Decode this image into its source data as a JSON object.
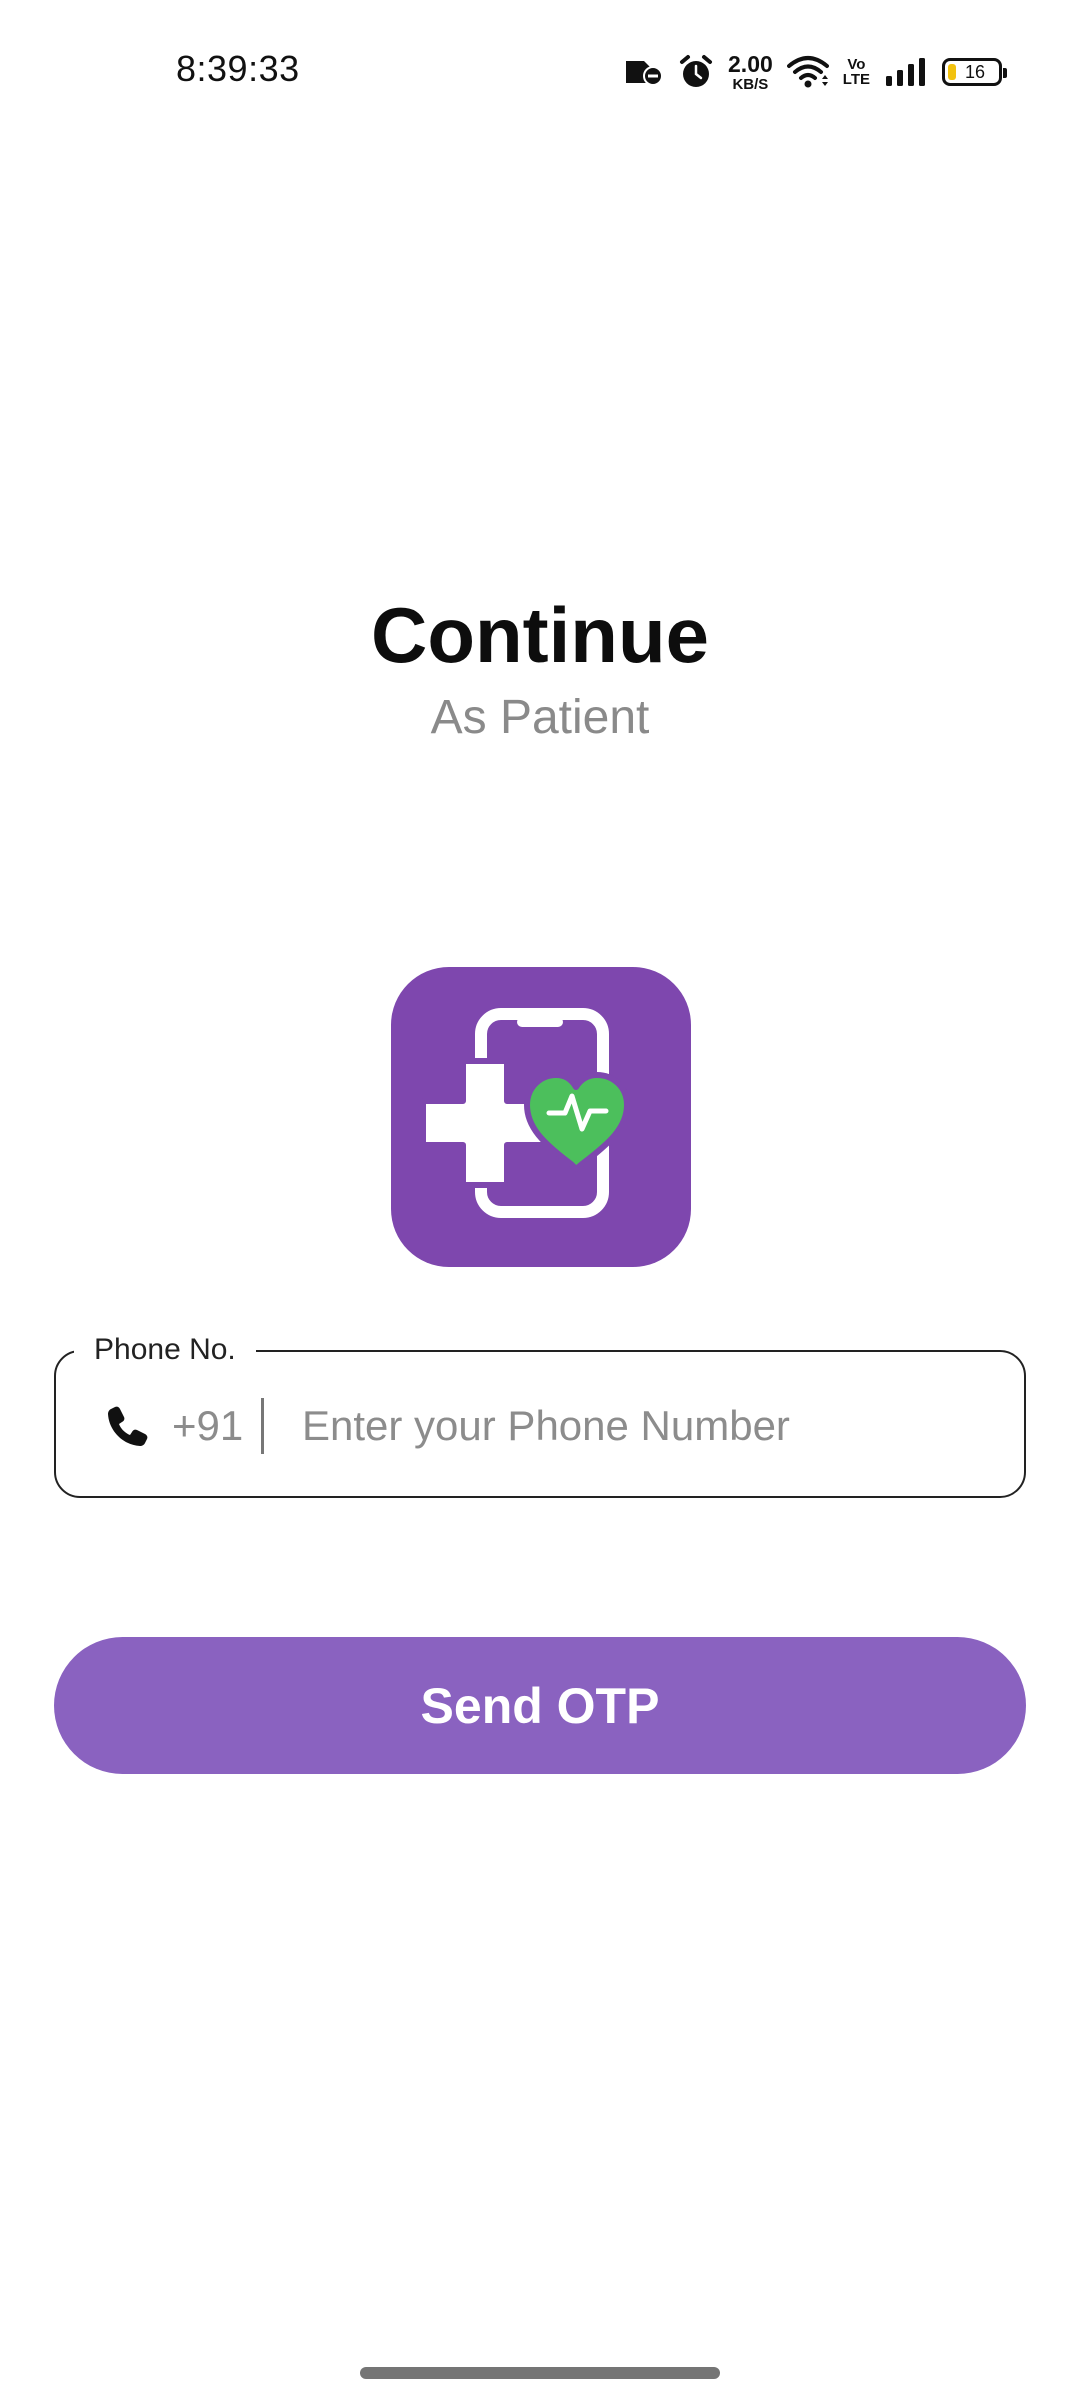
{
  "status_bar": {
    "time": "8:39:33",
    "net_speed_value": "2.00",
    "net_speed_unit": "KB/S",
    "volte_top": "Vo",
    "volte_bottom": "LTE",
    "battery_level": "16",
    "battery_color": "#f2c20f",
    "icons": [
      "sim-off-icon",
      "alarm-icon",
      "wifi-icon",
      "signal-icon",
      "battery-icon"
    ]
  },
  "header": {
    "title": "Continue",
    "subtitle": "As Patient"
  },
  "logo": {
    "icon": "health-app-logo-icon",
    "background_color": "#7e47ae",
    "heart_color": "#4cbf5c"
  },
  "phone_field": {
    "label": "Phone No.",
    "country_code": "+91",
    "placeholder": "Enter your Phone Number",
    "value": "",
    "icon": "phone-icon"
  },
  "actions": {
    "send_otp_label": "Send OTP",
    "button_color": "#8a62c0"
  }
}
